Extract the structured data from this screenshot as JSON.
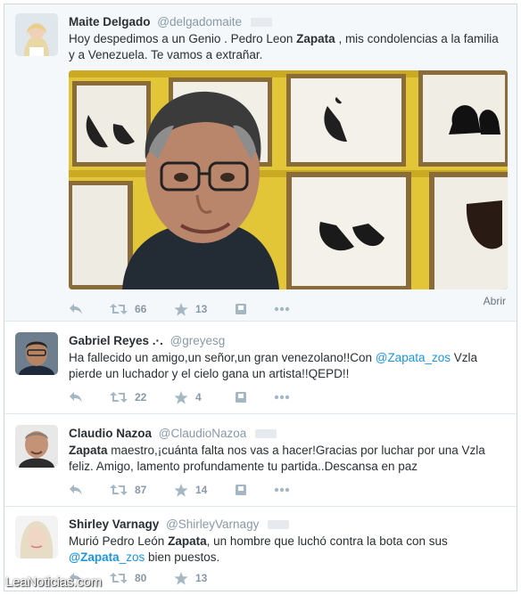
{
  "tweets": [
    {
      "fullname": "Maite Delgado",
      "handle": "@delgadomaite",
      "segments": [
        {
          "t": "Hoy despedimos a un Genio . Pedro Leon "
        },
        {
          "t": "Zapata",
          "b": true
        },
        {
          "t": " , mis condolencias a la familia y a Venezuela. Te vamos a extrañar."
        }
      ],
      "retweets": "66",
      "favorites": "13",
      "expand_label": "Abrir"
    },
    {
      "fullname": "Gabriel Reyes .·.",
      "handle": "@greyesg",
      "segments": [
        {
          "t": "Ha fallecido un amigo,un señor,un gran venezolano!!Con "
        },
        {
          "t": "@Zapata_zos",
          "m": true
        },
        {
          "t": "  Vzla pierde un luchador y el cielo gana un artista!!QEPD!!"
        }
      ],
      "retweets": "22",
      "favorites": "4"
    },
    {
      "fullname": "Claudio Nazoa",
      "handle": "@ClaudioNazoa",
      "segments": [
        {
          "t": "Zapata",
          "b": true
        },
        {
          "t": " maestro,¡cuánta falta nos vas a hacer!Gracias por luchar por una Vzla feliz. Amigo, lamento profundamente tu partida..Descansa en paz"
        }
      ],
      "retweets": "87",
      "favorites": "14"
    },
    {
      "fullname": "Shirley Varnagy",
      "handle": "@ShirleyVarnagy",
      "segments": [
        {
          "t": "Murió Pedro León "
        },
        {
          "t": "Zapata",
          "b": true
        },
        {
          "t": ", un hombre que luchó contra la bota con sus "
        },
        {
          "t": "@Zapata",
          "m": true,
          "b": true
        },
        {
          "t": "_zos",
          "m": true
        },
        {
          "t": " bien puestos."
        }
      ],
      "retweets": "80",
      "favorites": "13"
    }
  ],
  "watermark": "LeaNoticias.com",
  "icons": {
    "reply": "reply-icon",
    "retweet": "retweet-icon",
    "favorite": "star-icon",
    "save": "bookmark-icon",
    "more": "more-icon"
  },
  "colors": {
    "link": "#1b95e0",
    "meta": "#8899a6",
    "text": "#292f33"
  }
}
